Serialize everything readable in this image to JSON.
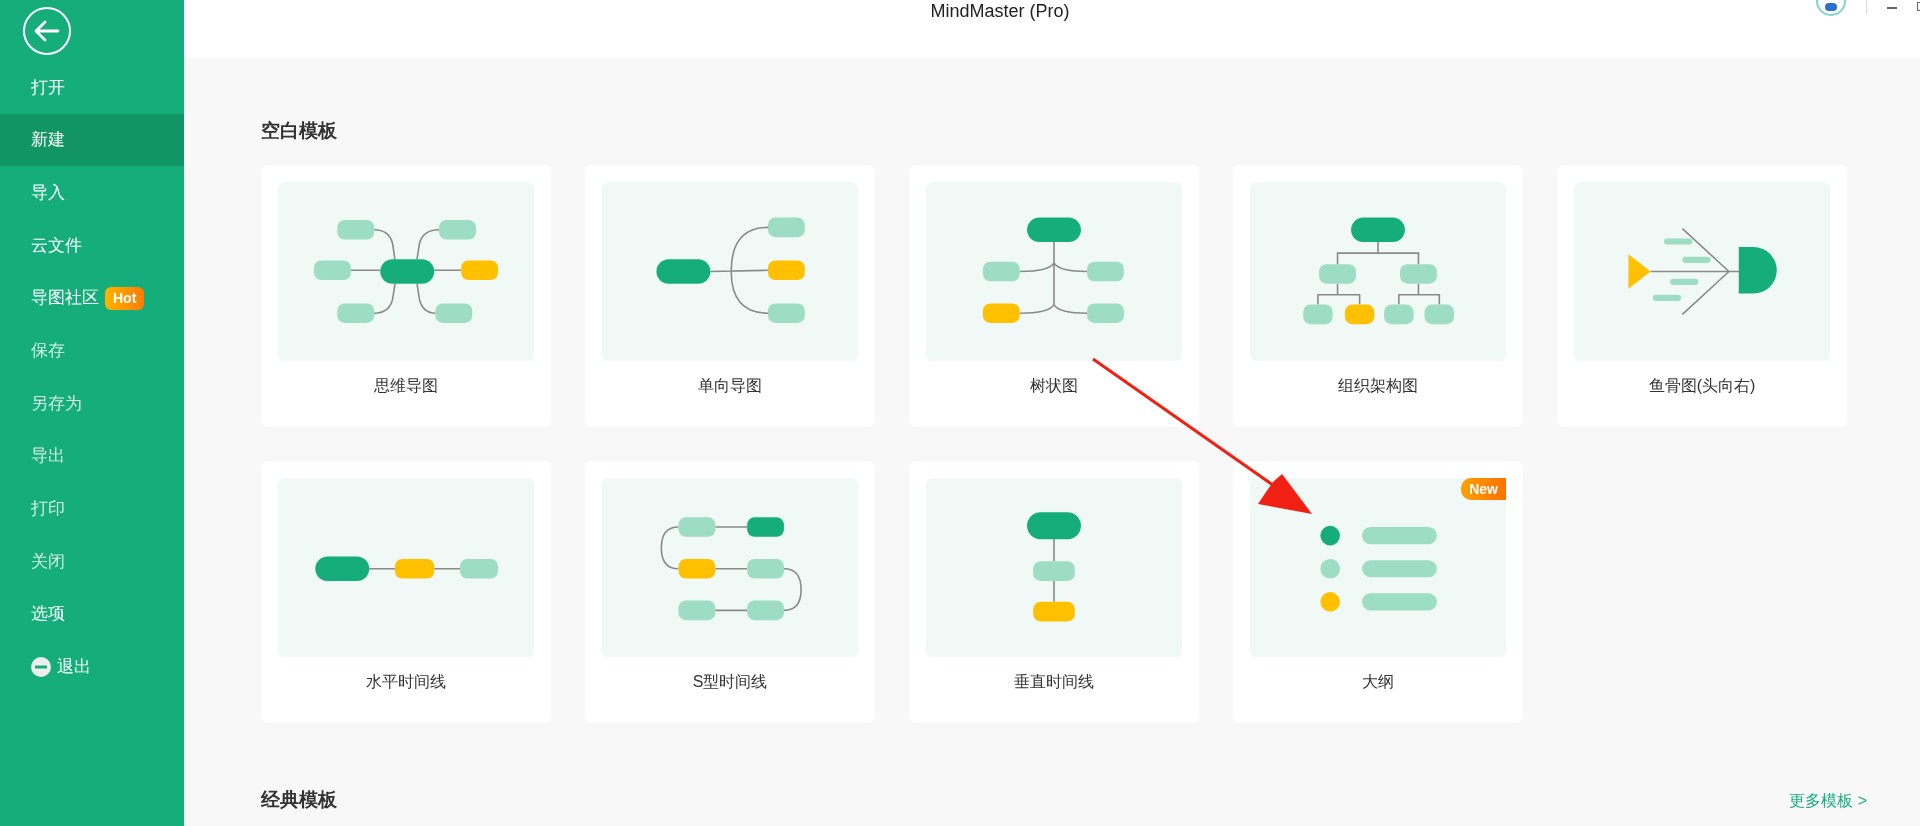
{
  "window": {
    "title": "MindMaster (Pro)"
  },
  "sidebar": {
    "items": [
      {
        "label": "打开",
        "kind": "plain",
        "selected": false,
        "disabled": false
      },
      {
        "label": "新建",
        "kind": "plain",
        "selected": true,
        "disabled": false
      },
      {
        "label": "导入",
        "kind": "plain",
        "selected": false,
        "disabled": false
      },
      {
        "label": "云文件",
        "kind": "plain",
        "selected": false,
        "disabled": false
      },
      {
        "label": "导图社区",
        "kind": "plain",
        "selected": false,
        "disabled": false,
        "badge": "Hot"
      },
      {
        "label": "保存",
        "kind": "plain",
        "selected": false,
        "disabled": true
      },
      {
        "label": "另存为",
        "kind": "plain",
        "selected": false,
        "disabled": true
      },
      {
        "label": "导出",
        "kind": "plain",
        "selected": false,
        "disabled": true
      },
      {
        "label": "打印",
        "kind": "plain",
        "selected": false,
        "disabled": true
      },
      {
        "label": "关闭",
        "kind": "plain",
        "selected": false,
        "disabled": true
      },
      {
        "label": "选项",
        "kind": "plain",
        "selected": false,
        "disabled": false
      },
      {
        "label": "退出",
        "kind": "exit",
        "selected": false,
        "disabled": false
      }
    ]
  },
  "blank_templates": {
    "heading": "空白模板",
    "templates": [
      {
        "label": "思维导图",
        "kind": "mind_map"
      },
      {
        "label": "单向导图",
        "kind": "right_map"
      },
      {
        "label": "树状图",
        "kind": "tree"
      },
      {
        "label": "组织架构图",
        "kind": "org_chart"
      },
      {
        "label": "鱼骨图(头向右)",
        "kind": "fishbone"
      },
      {
        "label": "水平时间线",
        "kind": "h_timeline"
      },
      {
        "label": "S型时间线",
        "kind": "s_timeline"
      },
      {
        "label": "垂直时间线",
        "kind": "v_timeline"
      },
      {
        "label": "大纲",
        "kind": "outline",
        "badge": "New"
      }
    ]
  },
  "classic_templates": {
    "heading": "经典模板",
    "more_link": "更多模板 >"
  }
}
